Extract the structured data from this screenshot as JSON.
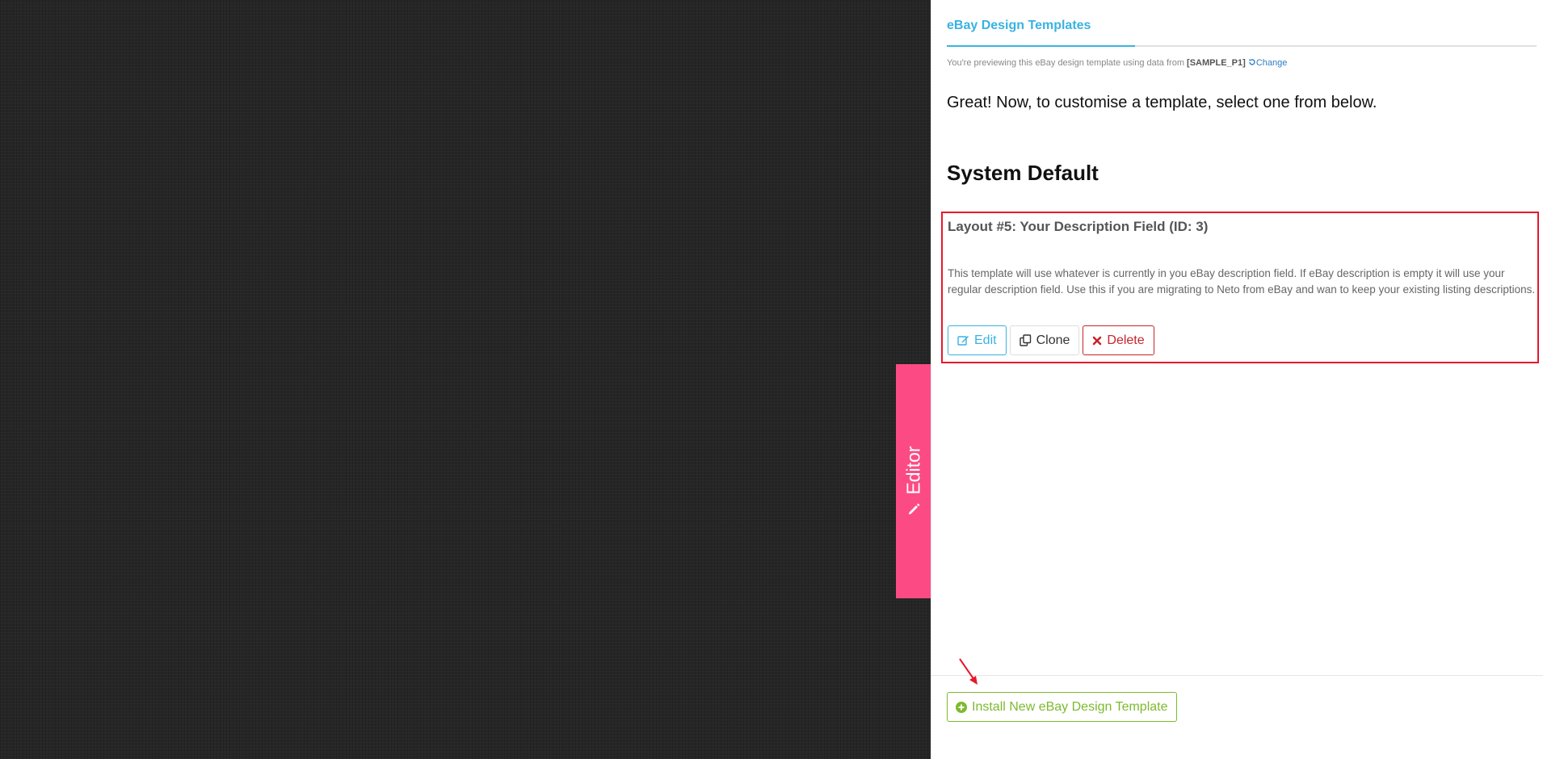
{
  "editor_tab": {
    "label": "Editor",
    "icon": "pencil-icon"
  },
  "panel": {
    "title": "eBay Design Templates",
    "preview_note": {
      "prefix": "You're previewing this eBay design template using data from",
      "sample": "[SAMPLE_P1]",
      "change_label": "Change"
    },
    "intro": "Great! Now, to customise a template, select one from below.",
    "section_title": "System Default"
  },
  "template_card": {
    "title": "Layout #5: Your Description Field (ID: 3)",
    "description": "This template will use whatever is currently in you eBay description field. If eBay description is empty it will use your regular description field. Use this if you are migrating to Neto from eBay and wan to keep your existing listing descriptions.",
    "buttons": {
      "edit": "Edit",
      "clone": "Clone",
      "delete": "Delete"
    }
  },
  "footer": {
    "install_label": "Install New eBay Design Template"
  },
  "colors": {
    "accent_blue": "#39b2e2",
    "editor_pink": "#fc4b84",
    "danger_red": "#c8242a",
    "highlight_red": "#e6192b",
    "success_green": "#7cba2f",
    "canvas_dark": "#262626"
  }
}
